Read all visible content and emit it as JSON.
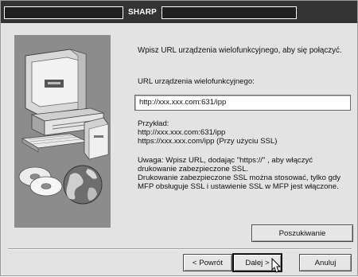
{
  "window": {
    "title": "SHARP"
  },
  "main": {
    "intro": "Wpisz URL urządzenia wielofunkcyjnego, aby się połączyć.",
    "url_label": "URL urządzenia wielofunkcyjnego:",
    "url_value": "http://xxx.xxx.com:631/ipp",
    "example": "Przykład:\nhttp://xxx.xxx.com:631/ipp\nhttps://xxx.xxx.com/ipp (Przy użyciu SSL)",
    "warning": "Uwaga: Wpisz URL, dodając \"https://\" , aby włączyć\ndrukowanie zabezpieczone SSL.\nDrukowanie zabezpieczone SSL można stosować, tylko gdy\nMFP obsługuje SSL i ustawienie SSL w MFP jest włączone."
  },
  "buttons": {
    "search": "Poszukiwanie",
    "back": "< Powrót",
    "next": "Dalej >",
    "cancel": "Anuluj"
  },
  "icons": {
    "illustration": "computer-printer-cd-globe-illustration",
    "cursor": "mouse-pointer-icon"
  }
}
